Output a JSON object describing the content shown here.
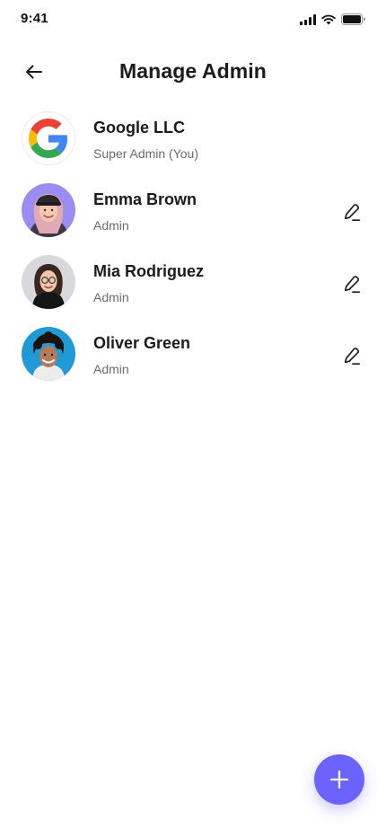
{
  "status_bar": {
    "time": "9:41"
  },
  "header": {
    "title": "Manage Admin"
  },
  "admins": [
    {
      "name": "Google LLC",
      "role": "Super Admin (You)",
      "avatar": "google-logo-icon",
      "editable": false
    },
    {
      "name": "Emma Brown",
      "role": "Admin",
      "avatar": "avatar-emma-brown",
      "editable": true
    },
    {
      "name": "Mia Rodriguez",
      "role": "Admin",
      "avatar": "avatar-mia-rodriguez",
      "editable": true
    },
    {
      "name": "Oliver Green",
      "role": "Admin",
      "avatar": "avatar-oliver-green",
      "editable": true
    }
  ],
  "fab": {
    "icon": "plus-icon"
  },
  "colors": {
    "accent": "#6c63ff",
    "text": "#1b1b1b",
    "subtext": "#6b6b6b"
  }
}
